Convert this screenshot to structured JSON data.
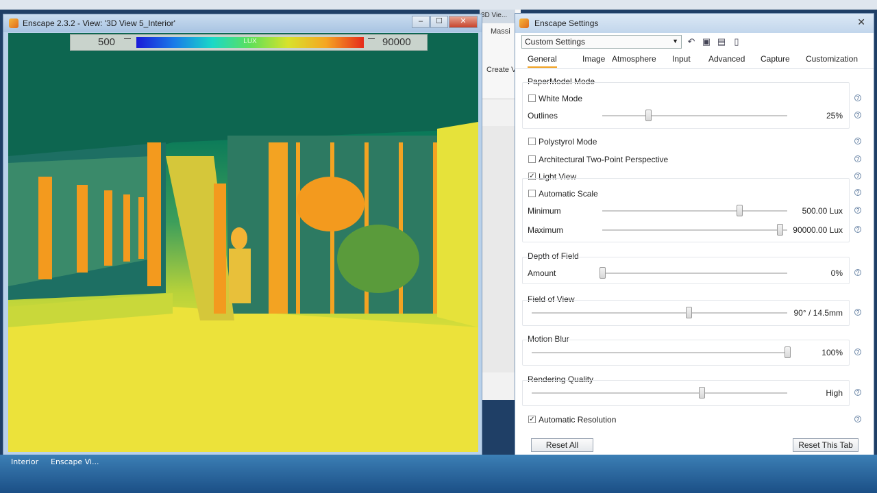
{
  "viewport_window": {
    "title": "Enscape 2.3.2 - View: '3D View 5_Interior'",
    "lux_legend": {
      "min": "500",
      "max": "90000",
      "unit_label": "LUX"
    }
  },
  "background_app": {
    "tab_label": "3D Vie...",
    "ribbon_tab": "Massi",
    "create_label": "Create V"
  },
  "taskbar": {
    "items": [
      "Interior",
      "Enscape Vi..."
    ]
  },
  "settings": {
    "title": "Enscape Settings",
    "preset": "Custom Settings",
    "tabs": [
      "General",
      "Image",
      "Atmosphere",
      "Input",
      "Advanced",
      "Capture",
      "Customization"
    ],
    "active_tab": "General",
    "papermodel": {
      "title": "PaperModel Mode",
      "white_mode": {
        "label": "White Mode",
        "checked": false
      },
      "outlines": {
        "label": "Outlines",
        "value": "25%"
      }
    },
    "polystyrol": {
      "label": "Polystyrol Mode",
      "checked": false
    },
    "two_point": {
      "label": "Architectural Two-Point Perspective",
      "checked": false
    },
    "light_view": {
      "label": "Light View",
      "checked": true,
      "automatic_scale": {
        "label": "Automatic Scale",
        "checked": false
      },
      "minimum": {
        "label": "Minimum",
        "value": "500.00 Lux"
      },
      "maximum": {
        "label": "Maximum",
        "value": "90000.00 Lux"
      }
    },
    "depth_of_field": {
      "title": "Depth of Field",
      "amount_label": "Amount",
      "value": "0%"
    },
    "field_of_view": {
      "title": "Field of View",
      "value": "90° / 14.5mm"
    },
    "motion_blur": {
      "title": "Motion Blur",
      "value": "100%"
    },
    "rendering_quality": {
      "title": "Rendering Quality",
      "value": "High"
    },
    "automatic_resolution": {
      "label": "Automatic Resolution",
      "checked": true
    },
    "reset_all": "Reset All",
    "reset_tab": "Reset This Tab"
  },
  "colors": {
    "accent_tab_underline": "#f0a020",
    "lux_low": "#1a1ad8",
    "lux_high": "#e62a1a"
  }
}
